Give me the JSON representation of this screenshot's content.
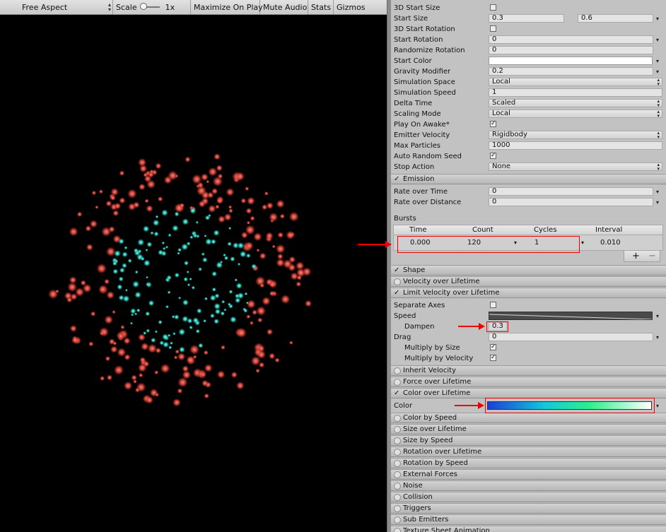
{
  "toolbar": {
    "aspect": "Free Aspect",
    "scale_label": "Scale",
    "scale_value": "1x",
    "maximize_on_play": "Maximize On Play",
    "mute_audio": "Mute Audio",
    "stats": "Stats",
    "gizmos": "Gizmos"
  },
  "main_module": {
    "start_size_3d": {
      "label": "3D Start Size",
      "checked": false
    },
    "start_size": {
      "label": "Start Size",
      "min": "0.3",
      "max": "0.6"
    },
    "start_rotation_3d": {
      "label": "3D Start Rotation",
      "checked": false
    },
    "start_rotation": {
      "label": "Start Rotation",
      "value": "0"
    },
    "randomize_rotation": {
      "label": "Randomize Rotation",
      "value": "0"
    },
    "start_color": {
      "label": "Start Color",
      "color": "#ffffff"
    },
    "gravity_modifier": {
      "label": "Gravity Modifier",
      "value": "0.2"
    },
    "simulation_space": {
      "label": "Simulation Space",
      "value": "Local"
    },
    "simulation_speed": {
      "label": "Simulation Speed",
      "value": "1"
    },
    "delta_time": {
      "label": "Delta Time",
      "value": "Scaled"
    },
    "scaling_mode": {
      "label": "Scaling Mode",
      "value": "Local"
    },
    "play_on_awake": {
      "label": "Play On Awake*",
      "checked": true
    },
    "emitter_velocity": {
      "label": "Emitter Velocity",
      "value": "Rigidbody"
    },
    "max_particles": {
      "label": "Max Particles",
      "value": "1000"
    },
    "auto_random_seed": {
      "label": "Auto Random Seed",
      "checked": true
    },
    "stop_action": {
      "label": "Stop Action",
      "value": "None"
    }
  },
  "emission": {
    "title": "Emission",
    "rate_over_time": {
      "label": "Rate over Time",
      "value": "0"
    },
    "rate_over_distance": {
      "label": "Rate over Distance",
      "value": "0"
    },
    "bursts_label": "Bursts",
    "bursts_columns": [
      "Time",
      "Count",
      "Cycles",
      "Interval"
    ],
    "burst": {
      "time": "0.000",
      "count": "120",
      "cycles": "1",
      "interval": "0.010"
    },
    "add": "+",
    "remove": "−"
  },
  "modules_a": [
    {
      "label": "Shape",
      "enabled": true
    },
    {
      "label": "Velocity over Lifetime",
      "enabled": false
    },
    {
      "label": "Limit Velocity over Lifetime",
      "enabled": true
    }
  ],
  "limit_velocity": {
    "separate_axes": {
      "label": "Separate Axes",
      "checked": false
    },
    "speed": {
      "label": "Speed"
    },
    "dampen": {
      "label": "Dampen",
      "value": "0.3"
    },
    "drag": {
      "label": "Drag",
      "value": "0"
    },
    "multiply_by_size": {
      "label": "Multiply by Size",
      "checked": true
    },
    "multiply_by_velocity": {
      "label": "Multiply by Velocity",
      "checked": true
    }
  },
  "modules_b": [
    {
      "label": "Inherit Velocity",
      "enabled": false
    },
    {
      "label": "Force over Lifetime",
      "enabled": false
    },
    {
      "label": "Color over Lifetime",
      "enabled": true
    }
  ],
  "color_over_lifetime": {
    "color_label": "Color",
    "gradient_colors": [
      "#1a3fd8",
      "#14c8d8",
      "#2bf08a",
      "#ffffff"
    ]
  },
  "modules_c": [
    {
      "label": "Color by Speed"
    },
    {
      "label": "Size over Lifetime"
    },
    {
      "label": "Size by Speed"
    },
    {
      "label": "Rotation over Lifetime"
    },
    {
      "label": "Rotation by Speed"
    },
    {
      "label": "External Forces"
    },
    {
      "label": "Noise"
    },
    {
      "label": "Collision"
    },
    {
      "label": "Triggers"
    },
    {
      "label": "Sub Emitters"
    },
    {
      "label": "Texture Sheet Animation"
    }
  ],
  "colors": {
    "outer_particle": "#e0554a",
    "inner_particle": "#2fd6c8",
    "annotation_red": "#ee0000"
  }
}
